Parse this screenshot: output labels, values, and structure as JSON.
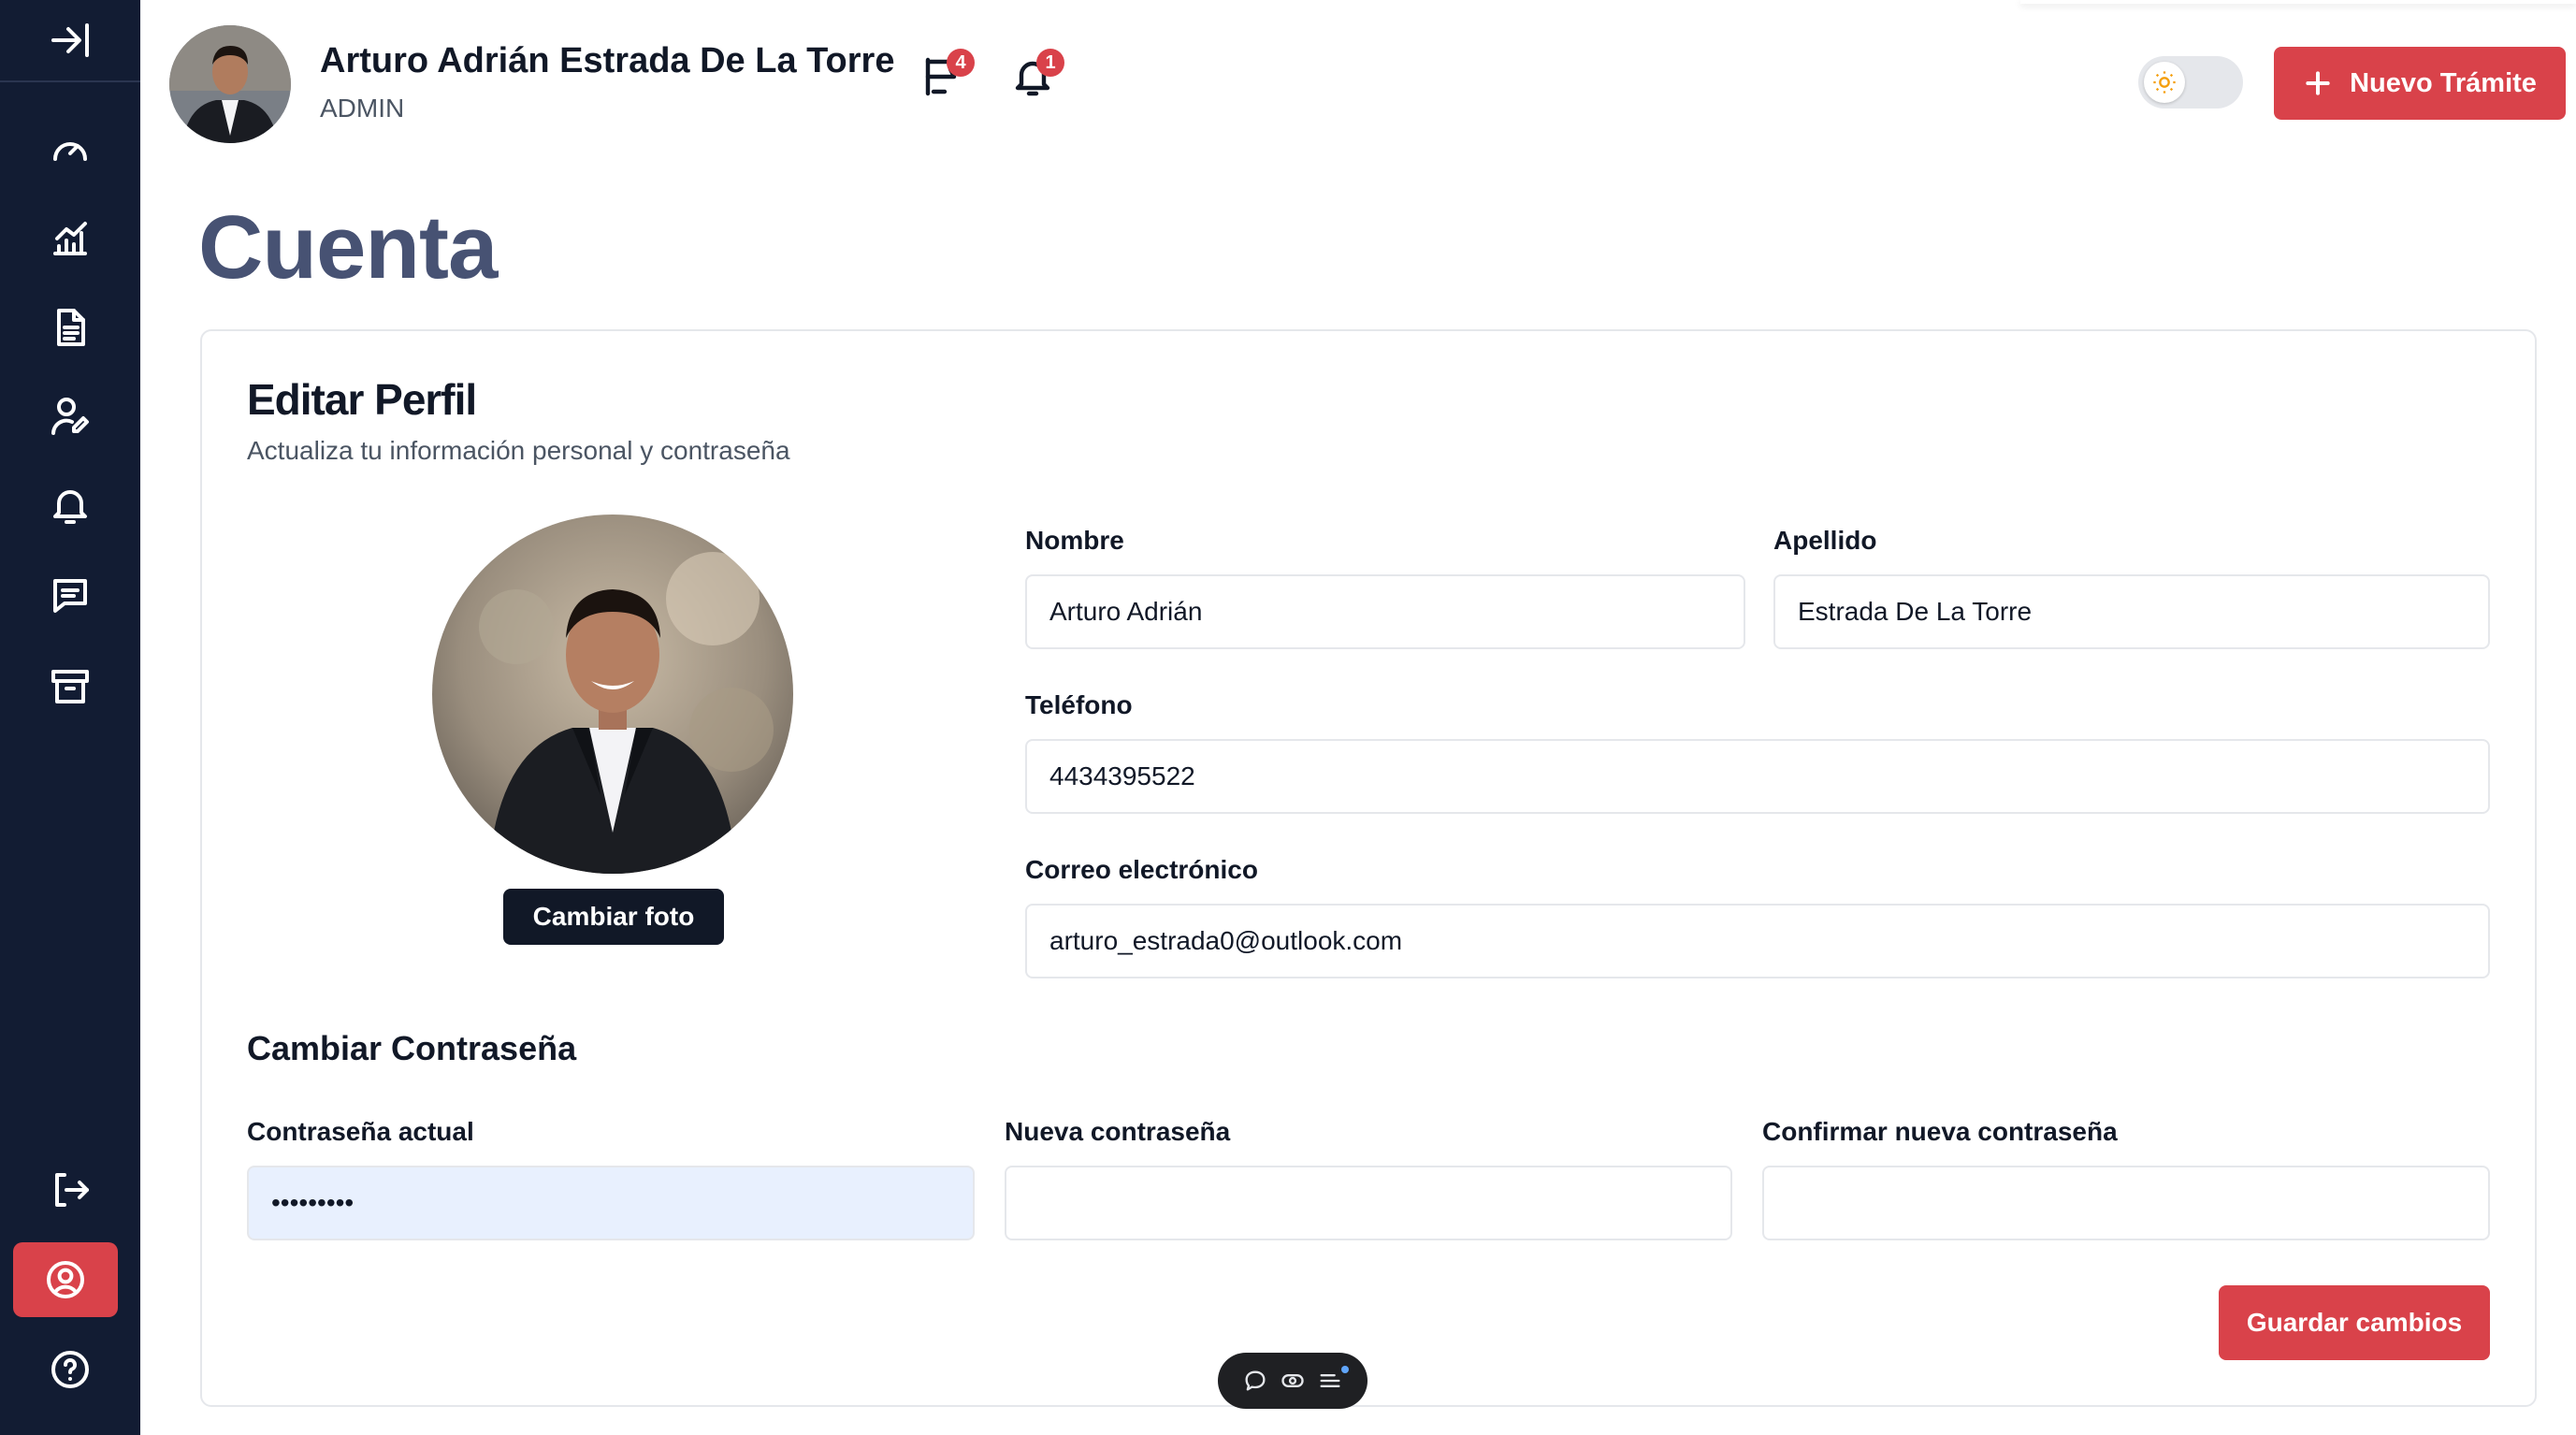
{
  "header": {
    "user_name": "Arturo Adrián Estrada De La Torre",
    "user_role": "ADMIN",
    "messages_badge": "4",
    "notifications_badge": "1",
    "new_button_label": "Nuevo Trámite"
  },
  "sidebar": {
    "items": [
      {
        "icon": "collapse-icon"
      },
      {
        "icon": "gauge-icon"
      },
      {
        "icon": "chart-icon"
      },
      {
        "icon": "document-icon"
      },
      {
        "icon": "user-edit-icon"
      },
      {
        "icon": "bell-icon"
      },
      {
        "icon": "message-icon"
      },
      {
        "icon": "archive-icon"
      },
      {
        "icon": "logout-icon"
      },
      {
        "icon": "user-circle-icon",
        "active": true
      },
      {
        "icon": "help-icon"
      }
    ],
    "active_color": "#d9424a",
    "background": "#121c33"
  },
  "page": {
    "title": "Cuenta"
  },
  "profile": {
    "title": "Editar Perfil",
    "subtitle": "Actualiza tu información personal y contraseña",
    "change_photo_label": "Cambiar foto",
    "fields": {
      "first_name": {
        "label": "Nombre",
        "value": "Arturo Adrián"
      },
      "last_name": {
        "label": "Apellido",
        "value": "Estrada De La Torre"
      },
      "phone": {
        "label": "Teléfono",
        "value": "4434395522"
      },
      "email": {
        "label": "Correo electrónico",
        "value": "arturo_estrada0@outlook.com"
      }
    }
  },
  "password": {
    "title": "Cambiar Contraseña",
    "current": {
      "label": "Contraseña actual",
      "value": "•••••••••"
    },
    "new": {
      "label": "Nueva contraseña",
      "value": ""
    },
    "confirm": {
      "label": "Confirmar nueva contraseña",
      "value": ""
    }
  },
  "actions": {
    "save_label": "Guardar cambios"
  }
}
